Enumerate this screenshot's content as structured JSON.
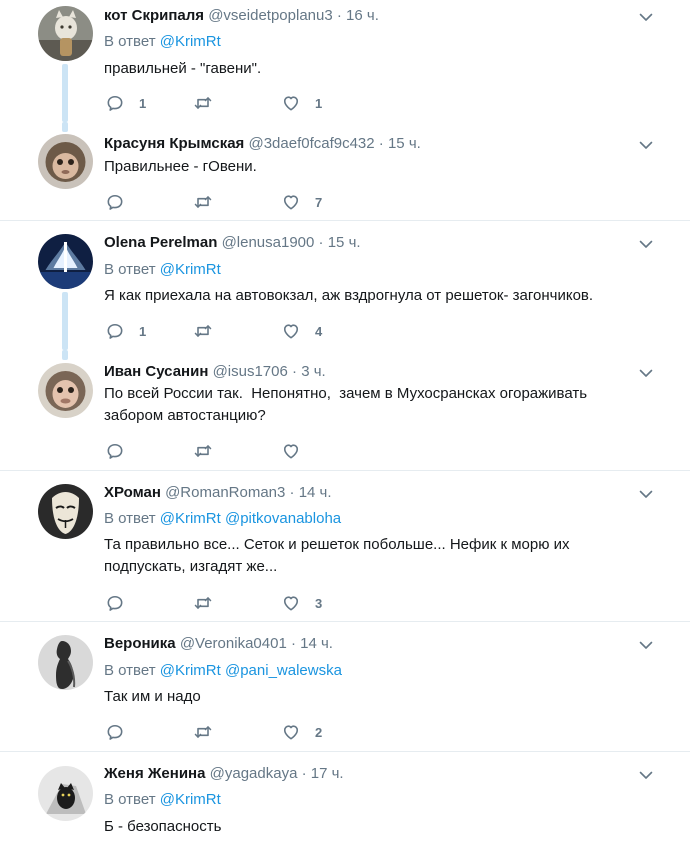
{
  "reply_prefix": "В ответ",
  "tweets": [
    {
      "name": "кот Скрипаля",
      "handle": "@vseidetpoplanu3",
      "dot": "·",
      "time": "16 ч.",
      "reply_to": [
        "@KrimRt"
      ],
      "text": "правильней - \"гавени\".",
      "replies": "1",
      "retweets": "",
      "likes": "1"
    },
    {
      "name": "Красуня Крымская",
      "handle": "@3daef0fcaf9c432",
      "dot": "·",
      "time": "15 ч.",
      "reply_to": [],
      "text": "Правильнее - гОвени.",
      "replies": "",
      "retweets": "",
      "likes": "7"
    },
    {
      "name": "Olena Perelman",
      "handle": "@lenusa1900",
      "dot": "·",
      "time": "15 ч.",
      "reply_to": [
        "@KrimRt"
      ],
      "text": "Я как приехала на автовокзал, аж вздрогнула от решеток- загончиков.",
      "replies": "1",
      "retweets": "",
      "likes": "4"
    },
    {
      "name": "Иван Сусанин",
      "handle": "@isus1706",
      "dot": "·",
      "time": "3 ч.",
      "reply_to": [],
      "text_lines": [
        "По всей России так.  Непонятно,  зачем в Мухосрансках огораживать",
        "забором автостанцию?"
      ],
      "replies": "",
      "retweets": "",
      "likes": ""
    },
    {
      "name": "ХРоман",
      "handle": "@RomanRoman3",
      "dot": "·",
      "time": "14 ч.",
      "reply_to": [
        "@KrimRt",
        "@pitkovanabloha"
      ],
      "text_lines": [
        "Та правильно все... Сеток и решеток побольше... Нефик к морю их",
        "подпускать, изгадят же..."
      ],
      "replies": "",
      "retweets": "",
      "likes": "3"
    },
    {
      "name": "Вероника",
      "handle": "@Veronika0401",
      "dot": "·",
      "time": "14 ч.",
      "reply_to": [
        "@KrimRt",
        "@pani_walewska"
      ],
      "text": "Так им и надо",
      "replies": "",
      "retweets": "",
      "likes": "2"
    },
    {
      "name": "Женя Женина",
      "handle": "@yagadkaya",
      "dot": "·",
      "time": "17 ч.",
      "reply_to": [
        "@KrimRt"
      ],
      "text": "Б - безопасность",
      "replies": "",
      "retweets": "",
      "likes": ""
    }
  ],
  "colors": {
    "text": "#14171a",
    "muted": "#657786",
    "link": "#1b95e0",
    "thread_line": "#cce4f5",
    "separator": "#e6ecf0"
  },
  "icons": [
    "reply-icon",
    "retweet-icon",
    "like-icon",
    "caret-down-icon"
  ]
}
